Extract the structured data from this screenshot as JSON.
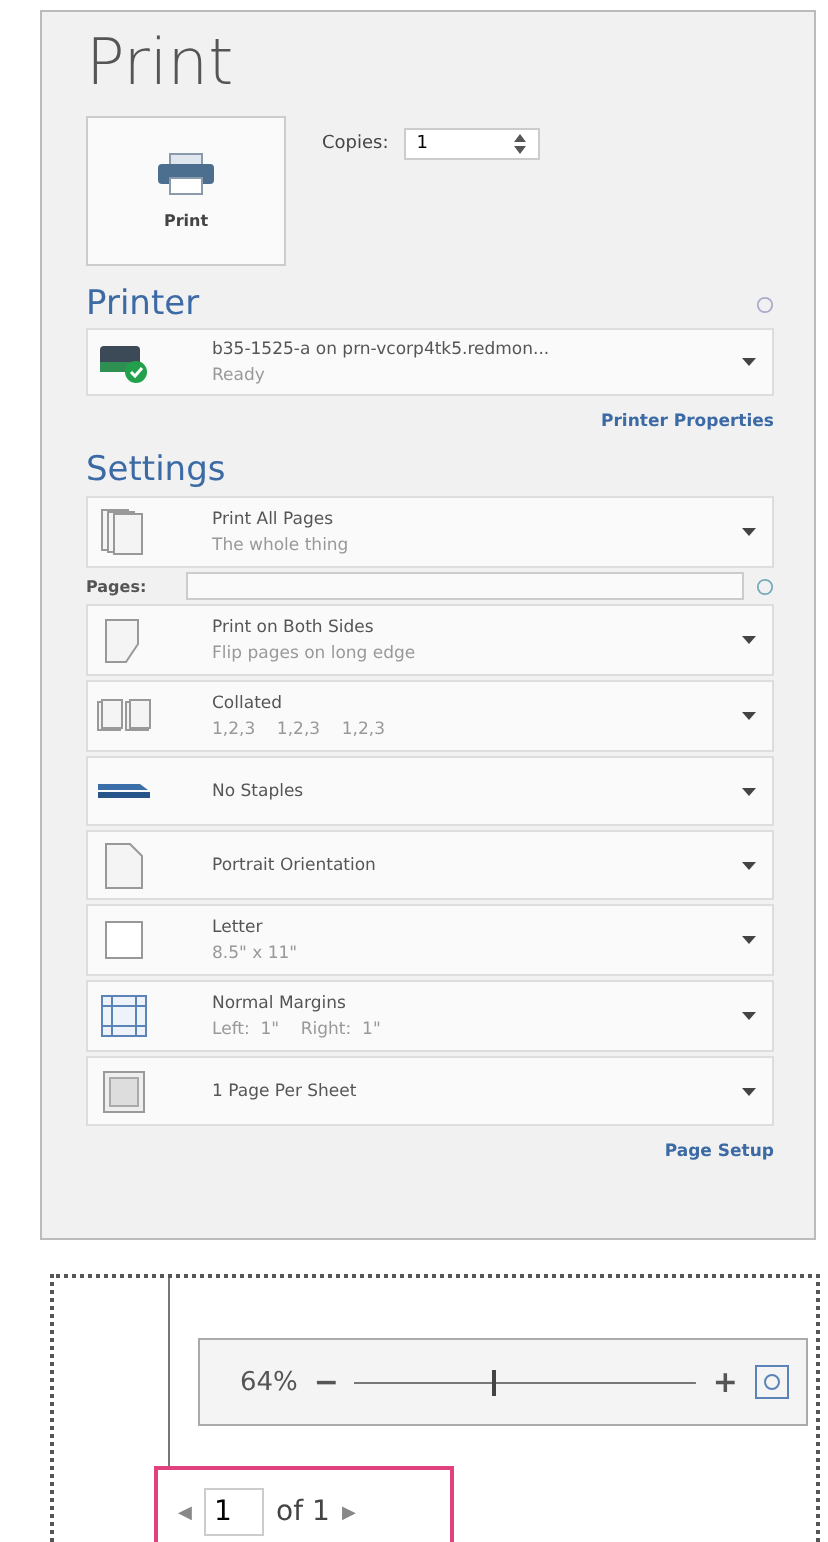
{
  "title": "Print",
  "print_button": {
    "label": "Print"
  },
  "copies": {
    "label": "Copies:",
    "value": "1"
  },
  "printer": {
    "heading": "Printer",
    "name": "b35-1525-a on prn-vcorp4tk5.redmon...",
    "status": "Ready",
    "properties_link": "Printer Properties"
  },
  "settings": {
    "heading": "Settings",
    "items": [
      {
        "kind": "pages",
        "title": "Print All Pages",
        "subtitle": "The whole thing"
      },
      {
        "kind": "pages_field",
        "label": "Pages:"
      },
      {
        "kind": "duplex",
        "title": "Print on Both Sides",
        "subtitle": "Flip pages on long edge"
      },
      {
        "kind": "collate",
        "title": "Collated",
        "subtitle": "1,2,3    1,2,3    1,2,3"
      },
      {
        "kind": "staple",
        "title": "No Staples"
      },
      {
        "kind": "orientation",
        "title": "Portrait Orientation"
      },
      {
        "kind": "paper",
        "title": "Letter",
        "subtitle": "8.5\" x 11\""
      },
      {
        "kind": "margins",
        "title": "Normal Margins",
        "subtitle": "Left:  1\"    Right:  1\""
      },
      {
        "kind": "persheet",
        "title": "1 Page Per Sheet"
      }
    ],
    "page_setup_link": "Page Setup"
  },
  "zoom": {
    "value": "64%",
    "minus": "−",
    "plus": "+",
    "level": 0.4
  },
  "page_nav": {
    "prev": "◀",
    "page": "1",
    "of": "of 1",
    "next": "▶"
  }
}
